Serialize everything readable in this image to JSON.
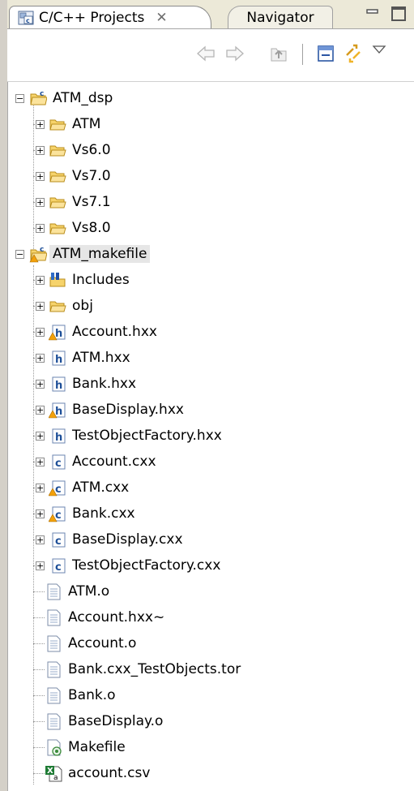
{
  "tabs": {
    "active": {
      "label": "C/C++ Projects",
      "close_glyph": "✕"
    },
    "inactive": {
      "label": "Navigator"
    }
  },
  "toolbar": {
    "back_icon": "arrow-left-icon",
    "forward_icon": "arrow-right-icon",
    "up_icon": "go-up-icon",
    "collapse_icon": "collapse-all-icon",
    "link_icon": "link-with-editor-icon",
    "menu_icon": "view-menu-icon"
  },
  "tree": {
    "projects": [
      {
        "name": "ATM_dsp",
        "children": [
          "ATM",
          "Vs6.0",
          "Vs7.0",
          "Vs7.1",
          "Vs8.0"
        ]
      },
      {
        "name": "ATM_makefile",
        "includes": "Includes",
        "folder": "obj",
        "headers": [
          "Account.hxx",
          "ATM.hxx",
          "Bank.hxx",
          "BaseDisplay.hxx",
          "TestObjectFactory.hxx"
        ],
        "sources": [
          "Account.cxx",
          "ATM.cxx",
          "Bank.cxx",
          "BaseDisplay.cxx",
          "TestObjectFactory.cxx"
        ],
        "plain_files": [
          "ATM.o",
          "Account.hxx~",
          "Account.o",
          "Bank.cxx_TestObjects.tor",
          "Bank.o",
          "BaseDisplay.o"
        ],
        "makefile": "Makefile",
        "csv": "account.csv"
      }
    ]
  },
  "colors": {
    "tab_bg": "#ece9d8",
    "folder": "#f6d36b",
    "header_icon": "#2c5faa",
    "warning": "#f3a10b"
  }
}
